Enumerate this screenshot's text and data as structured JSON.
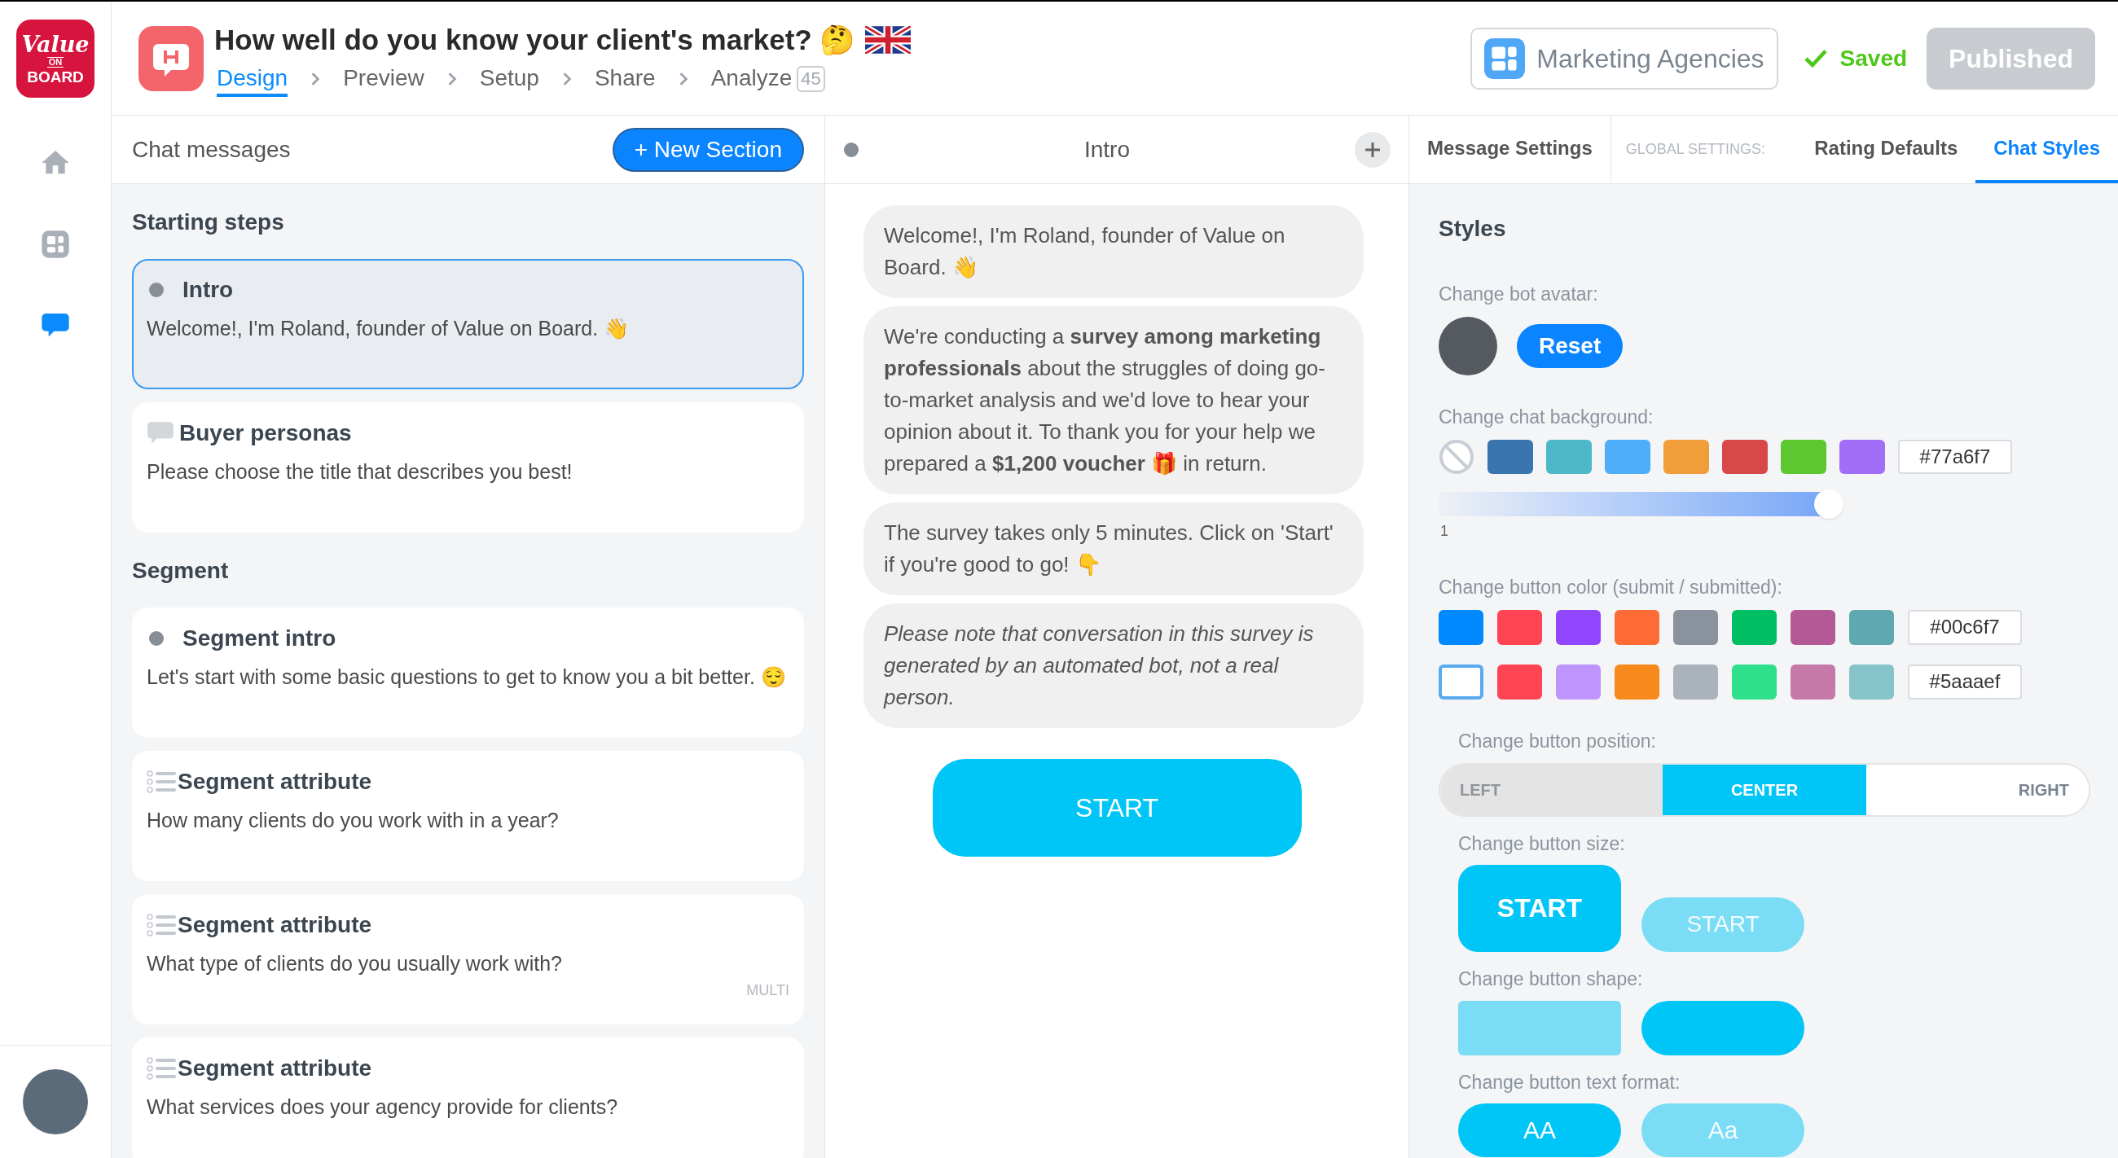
{
  "logo": {
    "line1": "Value",
    "line2": "ON",
    "line3": "BOARD"
  },
  "rail": [
    {
      "kind": "home",
      "selected": false
    },
    {
      "kind": "dashboard",
      "selected": false
    },
    {
      "kind": "chat",
      "selected": true
    }
  ],
  "header": {
    "title": "How well do you know your client's market? 🤔",
    "steps": [
      {
        "label": "Design",
        "selected": true
      },
      {
        "label": "Preview",
        "selected": false
      },
      {
        "label": "Setup",
        "selected": false
      },
      {
        "label": "Share",
        "selected": false
      },
      {
        "label": "Analyze",
        "selected": false,
        "count": "45"
      }
    ],
    "category": "Marketing Agencies",
    "status": "Saved",
    "publish": "Published"
  },
  "chat_panel": {
    "title": "Chat messages",
    "new_section": "+ New Section",
    "sections": [
      {
        "title": "Starting steps",
        "items": [
          {
            "kind": "message",
            "title": "Intro",
            "text": "Welcome!, I'm Roland, founder of Value on Board. 👋",
            "selected": true
          },
          {
            "kind": "persona",
            "title": "Buyer personas",
            "text": "Please choose the title that describes you best!",
            "selected": false
          }
        ]
      },
      {
        "title": "Segment",
        "items": [
          {
            "kind": "message",
            "title": "Segment intro",
            "text": "Let's start with some basic questions to get to know you a bit better. 😌",
            "selected": false
          },
          {
            "kind": "attribute",
            "title": "Segment attribute",
            "text": "How many clients do you work with in a year?",
            "selected": false
          },
          {
            "kind": "attribute",
            "title": "Segment attribute",
            "text": "What type of clients do you usually work with?",
            "tag": "MULTI",
            "selected": false
          },
          {
            "kind": "attribute",
            "title": "Segment attribute",
            "text": "What services does your agency provide for clients?",
            "selected": false
          }
        ]
      }
    ]
  },
  "preview": {
    "title": "Intro",
    "messages": [
      {
        "kind": "text",
        "text": "Welcome!, I'm Roland, founder of Value on Board. 👋"
      },
      {
        "kind": "text",
        "text": "We're conducting a **survey among marketing professionals** about the struggles of doing go-to-market analysis and we'd love to hear your opinion about it. To thank you for your help we prepared a **$1,200 voucher** 🎁 in return."
      },
      {
        "kind": "text",
        "text": "The survey takes only 5 minutes. Click on 'Start' if you're good to go! 👇"
      },
      {
        "kind": "note",
        "text": "Please note that conversation in this survey is generated by an automated bot, not a real person."
      }
    ],
    "start_button": "START"
  },
  "settings": {
    "tabs": [
      {
        "label": "Message Settings",
        "selected": false
      }
    ],
    "global_label": "GLOBAL SETTINGS:",
    "global_tabs": [
      {
        "label": "Rating Defaults",
        "selected": false
      },
      {
        "label": "Chat Styles",
        "selected": true
      }
    ],
    "heading": "Styles",
    "avatar_label": "Change bot avatar:",
    "reset": "Reset",
    "background_label": "Change chat background:",
    "background_swatches": [
      {
        "kind": "none"
      },
      {
        "kind": "color",
        "color": "#3a75b0"
      },
      {
        "kind": "color",
        "color": "#4db8c8"
      },
      {
        "kind": "color",
        "color": "#4faef9"
      },
      {
        "kind": "color",
        "color": "#f09e3a"
      },
      {
        "kind": "color",
        "color": "#d94848"
      },
      {
        "kind": "color",
        "color": "#5cc72e"
      },
      {
        "kind": "color",
        "color": "#a26df7"
      }
    ],
    "background_value": "#77a6f7",
    "opacity": {
      "level": 1,
      "reading": "1"
    },
    "button_color_label": "Change button color (submit / submitted):",
    "button_colors": [
      {
        "swatches": [
          {
            "color": "#0088ff",
            "selected": false
          },
          {
            "color": "#ff4553",
            "selected": false
          },
          {
            "color": "#9147ff",
            "selected": false
          },
          {
            "color": "#ff6b35",
            "selected": false
          },
          {
            "color": "#8a939d",
            "selected": false
          },
          {
            "color": "#00bf63",
            "selected": false
          },
          {
            "color": "#b55996",
            "selected": false
          },
          {
            "color": "#5ea8b0",
            "selected": false
          }
        ],
        "value": "#00c6f7"
      },
      {
        "swatches": [
          {
            "color": "#5aaaef",
            "selected": true
          },
          {
            "color": "#ff4553",
            "selected": false
          },
          {
            "color": "#bf94fc",
            "selected": false
          },
          {
            "color": "#f78a1a",
            "selected": false
          },
          {
            "color": "#aab2bb",
            "selected": false
          },
          {
            "color": "#2fe08a",
            "selected": false
          },
          {
            "color": "#c479a9",
            "selected": false
          },
          {
            "color": "#86c4c9",
            "selected": false
          }
        ],
        "value": "#5aaaef"
      }
    ],
    "position_label": "Change button position:",
    "positions": [
      {
        "label": "LEFT",
        "selected": false
      },
      {
        "label": "CENTER",
        "selected": true
      },
      {
        "label": "RIGHT",
        "selected": false
      }
    ],
    "size_label": "Change button size:",
    "sizes": [
      {
        "kind": "large",
        "label": "START",
        "selected": true
      },
      {
        "kind": "small",
        "label": "START",
        "selected": false
      }
    ],
    "shape_label": "Change button shape:",
    "shapes": [
      {
        "kind": "rect",
        "selected": false
      },
      {
        "kind": "pill",
        "selected": true
      }
    ],
    "format_label": "Change button text format:",
    "formats": [
      {
        "label": "AA",
        "selected": true
      },
      {
        "label": "Aa",
        "selected": false
      }
    ]
  }
}
